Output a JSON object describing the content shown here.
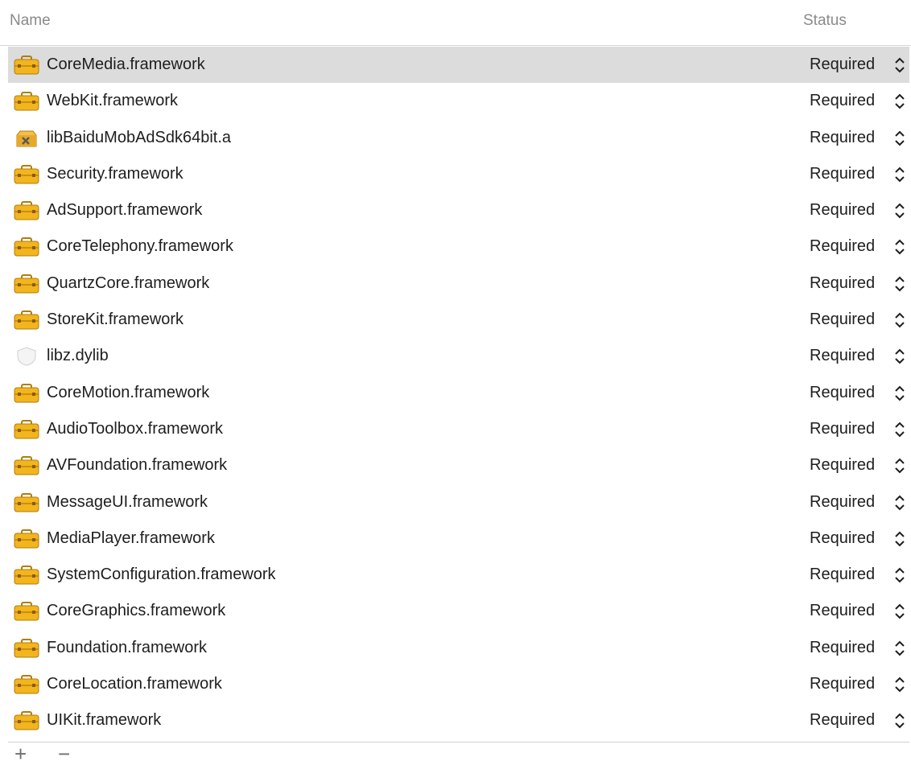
{
  "header": {
    "name_label": "Name",
    "status_label": "Status"
  },
  "rows": [
    {
      "name": "CoreMedia.framework",
      "status": "Required",
      "icon": "framework-toolbox-icon",
      "selected": true
    },
    {
      "name": "WebKit.framework",
      "status": "Required",
      "icon": "framework-toolbox-icon",
      "selected": false
    },
    {
      "name": "libBaiduMobAdSdk64bit.a",
      "status": "Required",
      "icon": "static-library-icon",
      "selected": false
    },
    {
      "name": "Security.framework",
      "status": "Required",
      "icon": "framework-toolbox-icon",
      "selected": false
    },
    {
      "name": "AdSupport.framework",
      "status": "Required",
      "icon": "framework-toolbox-icon",
      "selected": false
    },
    {
      "name": "CoreTelephony.framework",
      "status": "Required",
      "icon": "framework-toolbox-icon",
      "selected": false
    },
    {
      "name": "QuartzCore.framework",
      "status": "Required",
      "icon": "framework-toolbox-icon",
      "selected": false
    },
    {
      "name": "StoreKit.framework",
      "status": "Required",
      "icon": "framework-toolbox-icon",
      "selected": false
    },
    {
      "name": "libz.dylib",
      "status": "Required",
      "icon": "dylib-shield-icon",
      "selected": false
    },
    {
      "name": "CoreMotion.framework",
      "status": "Required",
      "icon": "framework-toolbox-icon",
      "selected": false
    },
    {
      "name": "AudioToolbox.framework",
      "status": "Required",
      "icon": "framework-toolbox-icon",
      "selected": false
    },
    {
      "name": "AVFoundation.framework",
      "status": "Required",
      "icon": "framework-toolbox-icon",
      "selected": false
    },
    {
      "name": "MessageUI.framework",
      "status": "Required",
      "icon": "framework-toolbox-icon",
      "selected": false
    },
    {
      "name": "MediaPlayer.framework",
      "status": "Required",
      "icon": "framework-toolbox-icon",
      "selected": false
    },
    {
      "name": "SystemConfiguration.framework",
      "status": "Required",
      "icon": "framework-toolbox-icon",
      "selected": false
    },
    {
      "name": "CoreGraphics.framework",
      "status": "Required",
      "icon": "framework-toolbox-icon",
      "selected": false
    },
    {
      "name": "Foundation.framework",
      "status": "Required",
      "icon": "framework-toolbox-icon",
      "selected": false
    },
    {
      "name": "CoreLocation.framework",
      "status": "Required",
      "icon": "framework-toolbox-icon",
      "selected": false
    },
    {
      "name": "UIKit.framework",
      "status": "Required",
      "icon": "framework-toolbox-icon",
      "selected": false
    }
  ],
  "footer": {
    "add_glyph": "+",
    "remove_glyph": "−"
  },
  "colors": {
    "selected_row": "#dcdcdc",
    "toolbox_yellow": "#f2b51e",
    "header_text": "#8a8a8a"
  }
}
